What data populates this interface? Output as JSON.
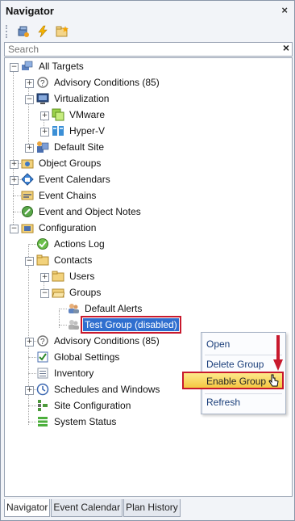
{
  "panel": {
    "title": "Navigator",
    "close_glyph": "×"
  },
  "toolbar": {
    "icons": [
      "add-target-icon",
      "lightning-icon",
      "folder-star-icon"
    ]
  },
  "search": {
    "placeholder": "Search",
    "clear_glyph": "×"
  },
  "tree": {
    "all_targets": "All Targets",
    "advisory_conditions_1": "Advisory Conditions (85)",
    "virtualization": "Virtualization",
    "vmware": "VMware",
    "hyperv": "Hyper-V",
    "default_site": "Default Site",
    "object_groups": "Object Groups",
    "event_calendars": "Event Calendars",
    "event_chains": "Event Chains",
    "event_notes": "Event and Object Notes",
    "configuration": "Configuration",
    "actions_log": "Actions Log",
    "contacts": "Contacts",
    "users": "Users",
    "groups": "Groups",
    "default_alerts": "Default Alerts",
    "test_group": "Test Group (disabled)",
    "advisory_conditions_2": "Advisory Conditions (85)",
    "global_settings": "Global Settings",
    "inventory": "Inventory",
    "schedules": "Schedules and Windows",
    "site_configuration": "Site Configuration",
    "system_status": "System Status"
  },
  "context_menu": {
    "open": "Open",
    "delete_group": "Delete Group",
    "enable_group": "Enable Group",
    "refresh": "Refresh"
  },
  "tabs": [
    "Navigator",
    "Event Calendar",
    "Plan History"
  ],
  "colors": {
    "selection": "#2f6fcf",
    "highlight_border": "#c8192d",
    "menu_highlight": "#f5c842"
  }
}
